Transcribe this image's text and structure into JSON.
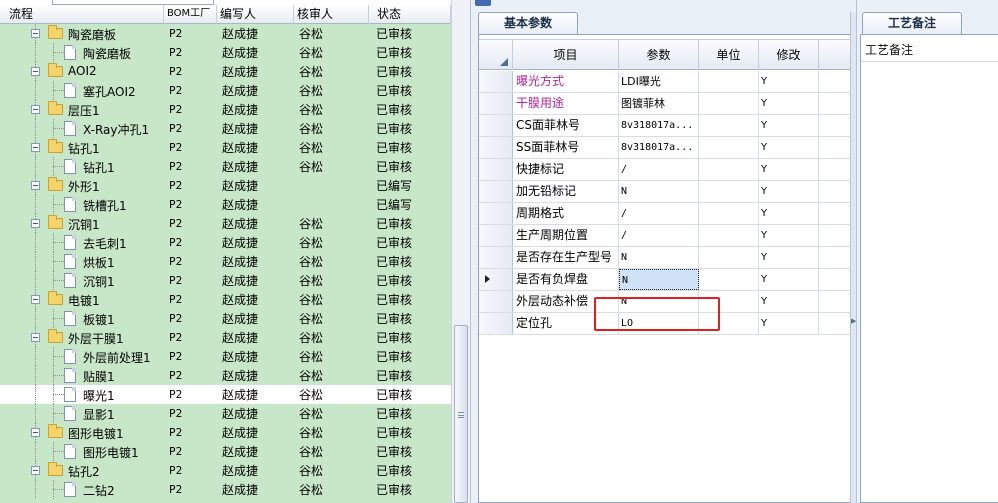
{
  "tree": {
    "columns": {
      "flow": "流程",
      "bom": "BOM工厂",
      "author": "编写人",
      "reviewer": "核审人",
      "status": "状态"
    },
    "rows": [
      {
        "level": 2,
        "type": "folder",
        "name": "陶瓷磨板",
        "bom": "P2",
        "author": "赵成捷",
        "reviewer": "谷松",
        "status": "已审核"
      },
      {
        "level": 3,
        "type": "doc",
        "name": "陶瓷磨板",
        "bom": "P2",
        "author": "赵成捷",
        "reviewer": "谷松",
        "status": "已审核"
      },
      {
        "level": 2,
        "type": "folder",
        "name": "AOI2",
        "bom": "P2",
        "author": "赵成捷",
        "reviewer": "谷松",
        "status": "已审核"
      },
      {
        "level": 3,
        "type": "doc",
        "name": "塞孔AOI2",
        "bom": "P2",
        "author": "赵成捷",
        "reviewer": "谷松",
        "status": "已审核"
      },
      {
        "level": 2,
        "type": "folder",
        "name": "层压1",
        "bom": "P2",
        "author": "赵成捷",
        "reviewer": "谷松",
        "status": "已审核"
      },
      {
        "level": 3,
        "type": "doc",
        "name": "X-Ray冲孔1",
        "bom": "P2",
        "author": "赵成捷",
        "reviewer": "谷松",
        "status": "已审核"
      },
      {
        "level": 2,
        "type": "folder",
        "name": "钻孔1",
        "bom": "P2",
        "author": "赵成捷",
        "reviewer": "谷松",
        "status": "已审核"
      },
      {
        "level": 3,
        "type": "doc",
        "name": "钻孔1",
        "bom": "P2",
        "author": "赵成捷",
        "reviewer": "谷松",
        "status": "已审核"
      },
      {
        "level": 2,
        "type": "folder",
        "name": "外形1",
        "bom": "P2",
        "author": "赵成捷",
        "reviewer": "",
        "status": "已编写"
      },
      {
        "level": 3,
        "type": "doc",
        "name": "铣槽孔1",
        "bom": "P2",
        "author": "赵成捷",
        "reviewer": "",
        "status": "已编写"
      },
      {
        "level": 2,
        "type": "folder",
        "name": "沉铜1",
        "bom": "P2",
        "author": "赵成捷",
        "reviewer": "谷松",
        "status": "已审核"
      },
      {
        "level": 3,
        "type": "doc",
        "name": "去毛刺1",
        "bom": "P2",
        "author": "赵成捷",
        "reviewer": "谷松",
        "status": "已审核"
      },
      {
        "level": 3,
        "type": "doc",
        "name": "烘板1",
        "bom": "P2",
        "author": "赵成捷",
        "reviewer": "谷松",
        "status": "已审核"
      },
      {
        "level": 3,
        "type": "doc",
        "name": "沉铜1",
        "bom": "P2",
        "author": "赵成捷",
        "reviewer": "谷松",
        "status": "已审核"
      },
      {
        "level": 2,
        "type": "folder",
        "name": "电镀1",
        "bom": "P2",
        "author": "赵成捷",
        "reviewer": "谷松",
        "status": "已审核"
      },
      {
        "level": 3,
        "type": "doc",
        "name": "板镀1",
        "bom": "P2",
        "author": "赵成捷",
        "reviewer": "谷松",
        "status": "已审核"
      },
      {
        "level": 2,
        "type": "folder",
        "name": "外层干膜1",
        "bom": "P2",
        "author": "赵成捷",
        "reviewer": "谷松",
        "status": "已审核"
      },
      {
        "level": 3,
        "type": "doc",
        "name": "外层前处理1",
        "bom": "P2",
        "author": "赵成捷",
        "reviewer": "谷松",
        "status": "已审核"
      },
      {
        "level": 3,
        "type": "doc",
        "name": "贴膜1",
        "bom": "P2",
        "author": "赵成捷",
        "reviewer": "谷松",
        "status": "已审核"
      },
      {
        "level": 3,
        "type": "doc",
        "name": "曝光1",
        "bom": "P2",
        "author": "赵成捷",
        "reviewer": "谷松",
        "status": "已审核",
        "selected": true
      },
      {
        "level": 3,
        "type": "doc",
        "name": "显影1",
        "bom": "P2",
        "author": "赵成捷",
        "reviewer": "谷松",
        "status": "已审核"
      },
      {
        "level": 2,
        "type": "folder",
        "name": "图形电镀1",
        "bom": "P2",
        "author": "赵成捷",
        "reviewer": "谷松",
        "status": "已审核"
      },
      {
        "level": 3,
        "type": "doc",
        "name": "图形电镀1",
        "bom": "P2",
        "author": "赵成捷",
        "reviewer": "谷松",
        "status": "已审核"
      },
      {
        "level": 2,
        "type": "folder",
        "name": "钻孔2",
        "bom": "P2",
        "author": "赵成捷",
        "reviewer": "谷松",
        "status": "已审核"
      },
      {
        "level": 3,
        "type": "doc",
        "name": "二钻2",
        "bom": "P2",
        "author": "赵成捷",
        "reviewer": "谷松",
        "status": "已审核"
      }
    ]
  },
  "middle": {
    "subtab": "基本参数",
    "grid": {
      "headers": {
        "item": "项目",
        "param": "参数",
        "unit": "单位",
        "mod": "修改"
      },
      "rows": [
        {
          "item": "曝光方式",
          "param": "LDI曝光",
          "unit": "",
          "mod": "Y",
          "pink": true,
          "cjk": true
        },
        {
          "item": "干膜用途",
          "param": "图镀菲林",
          "unit": "",
          "mod": "Y",
          "pink": true,
          "cjk": true
        },
        {
          "item": "CS面菲林号",
          "param": "8v318017a...",
          "unit": "",
          "mod": "Y"
        },
        {
          "item": "SS面菲林号",
          "param": "8v318017a...",
          "unit": "",
          "mod": "Y"
        },
        {
          "item": "快捷标记",
          "param": "/",
          "unit": "",
          "mod": "Y"
        },
        {
          "item": "加无铅标记",
          "param": "N",
          "unit": "",
          "mod": "Y"
        },
        {
          "item": "周期格式",
          "param": "/",
          "unit": "",
          "mod": "Y"
        },
        {
          "item": "生产周期位置",
          "param": "/",
          "unit": "",
          "mod": "Y"
        },
        {
          "item": "是否存在生产型号",
          "param": "N",
          "unit": "",
          "mod": "Y"
        },
        {
          "item": "是否有负焊盘",
          "param": "N",
          "unit": "",
          "mod": "Y",
          "current": true
        },
        {
          "item": "外层动态补偿",
          "param": "N",
          "unit": "",
          "mod": "Y"
        },
        {
          "item": "定位孔",
          "param": "LO",
          "unit": "",
          "mod": "Y"
        }
      ]
    }
  },
  "right": {
    "tab": "工艺备注",
    "label": "工艺备注"
  },
  "colors": {
    "tree_row_bg": "#c8e6c8",
    "accent_pink": "#b4259a",
    "highlight_red": "#e02020",
    "editing_cell": "#cfe2f7"
  }
}
